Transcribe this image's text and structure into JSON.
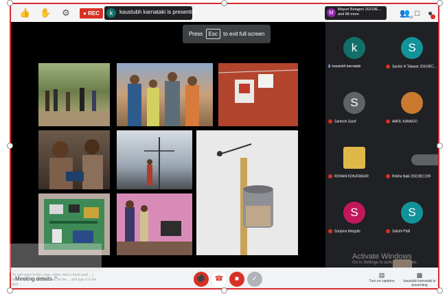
{
  "topbar": {
    "rec_label": "REC",
    "presenter_initial": "k",
    "presenter_text": "kaustubh karnataki is presenting",
    "people_initial": "M",
    "people_text": "Mayuri Belageri 2GI19E... and 88 more",
    "participant_count": "93",
    "icons": [
      "thumbs-up-icon",
      "hand-icon",
      "gear-icon",
      "people-icon",
      "chat-icon",
      "avatar-icon"
    ]
  },
  "stage": {
    "esc_prefix": "Press",
    "esc_key": "Esc",
    "esc_suffix": "to exit full screen"
  },
  "participants": [
    {
      "initial": "k",
      "name": "kaustubh karnataki",
      "color": "#12706a",
      "muted": false
    },
    {
      "initial": "S",
      "name": "Sachin H Talawar 2GI19EC...",
      "color": "#12939a",
      "muted": true
    },
    {
      "initial": "S",
      "name": "Santosh Saraf",
      "color": "#5f6368",
      "muted": true
    },
    {
      "initial": "",
      "name": "AMOL KANAGO",
      "color": "#c97a2e",
      "muted": true
    },
    {
      "initial": "",
      "name": "ROHAN KOKATANUR",
      "color": "#e0b84a",
      "muted": true
    },
    {
      "initial": "",
      "name": "Rekha Naik 2GI19EC109",
      "color": "#3c4043",
      "muted": true
    },
    {
      "initial": "S",
      "name": "Sanjana Margale",
      "color": "#c2185b",
      "muted": true
    },
    {
      "initial": "S",
      "name": "Sakshi Patil",
      "color": "#12939a",
      "muted": true
    }
  ],
  "watermark": {
    "title": "Activate Windows",
    "subtitle": "Go to Settings to activate Windows."
  },
  "bottombar": {
    "meeting_details": "Meeting details",
    "captions_label": "Turn on captions",
    "presenting_label": "kaustubh karnataki is presenting",
    "colors": {
      "mic_off": "#d93025",
      "hangup": "#ffffff",
      "camera_off": "#d93025",
      "accept": "#b0b3b8"
    }
  },
  "overlay": {
    "text": "To add tasks to this class, either start a fresh (and ... ) then ... you or click the ... ice for the ... and type it in the tool"
  }
}
